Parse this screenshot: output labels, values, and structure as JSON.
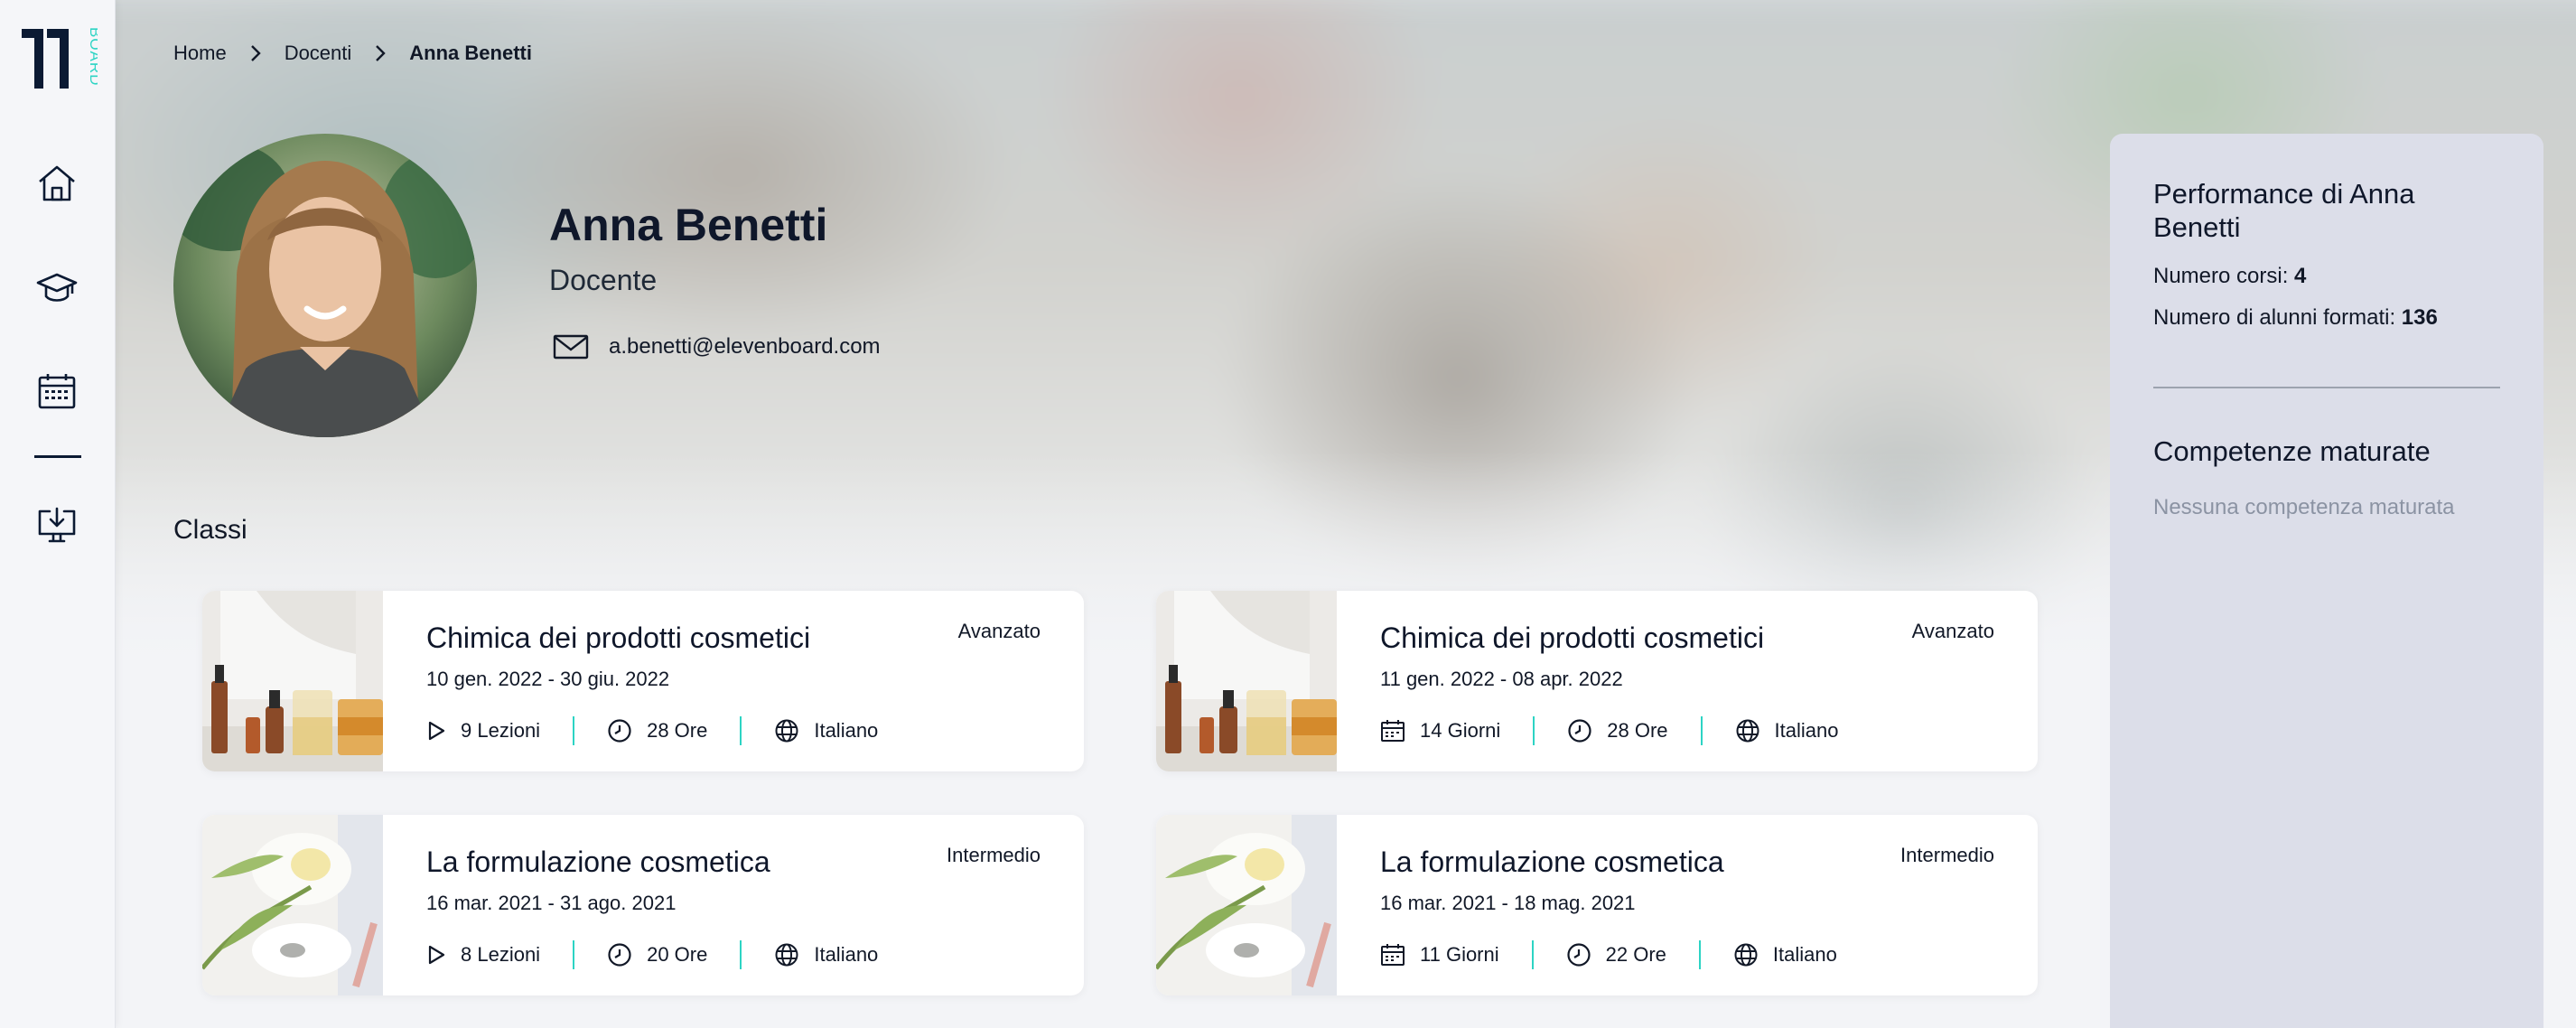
{
  "brand": {
    "logo_text": "BOARD",
    "accent": "#2dd4c4",
    "dark": "#0b1a33"
  },
  "sidebar": {
    "items": [
      {
        "name": "home",
        "icon": "home-icon"
      },
      {
        "name": "courses",
        "icon": "graduation-cap-icon"
      },
      {
        "name": "calendar",
        "icon": "calendar-icon"
      },
      {
        "name": "download",
        "icon": "download-icon"
      }
    ]
  },
  "breadcrumb": [
    "Home",
    "Docenti",
    "Anna Benetti"
  ],
  "profile": {
    "name": "Anna Benetti",
    "role": "Docente",
    "email": "a.benetti@elevenboard.com"
  },
  "classes": {
    "title": "Classi",
    "items": [
      {
        "title": "Chimica dei prodotti cosmetici",
        "level": "Avanzato",
        "dates": "10 gen. 2022 - 30 giu. 2022",
        "meta1_icon": "play-icon",
        "meta1": "9 Lezioni",
        "meta2": "28 Ore",
        "meta3": "Italiano"
      },
      {
        "title": "Chimica dei prodotti cosmetici",
        "level": "Avanzato",
        "dates": "11 gen. 2022 - 08 apr. 2022",
        "meta1_icon": "calendar-icon",
        "meta1": "14 Giorni",
        "meta2": "28 Ore",
        "meta3": "Italiano"
      },
      {
        "title": "La formulazione cosmetica",
        "level": "Intermedio",
        "dates": "16 mar. 2021 - 31 ago. 2021",
        "meta1_icon": "play-icon",
        "meta1": "8 Lezioni",
        "meta2": "20 Ore",
        "meta3": "Italiano"
      },
      {
        "title": "La formulazione cosmetica",
        "level": "Intermedio",
        "dates": "16 mar. 2021 - 18 mag. 2021",
        "meta1_icon": "calendar-icon",
        "meta1": "11 Giorni",
        "meta2": "22 Ore",
        "meta3": "Italiano"
      }
    ]
  },
  "panel": {
    "title": "Performance di Anna Benetti",
    "courses_label": "Numero corsi: ",
    "courses_value": "4",
    "students_label": "Numero di alunni formati: ",
    "students_value": "136",
    "skills_title": "Competenze maturate",
    "skills_empty": "Nessuna competenza maturata"
  }
}
